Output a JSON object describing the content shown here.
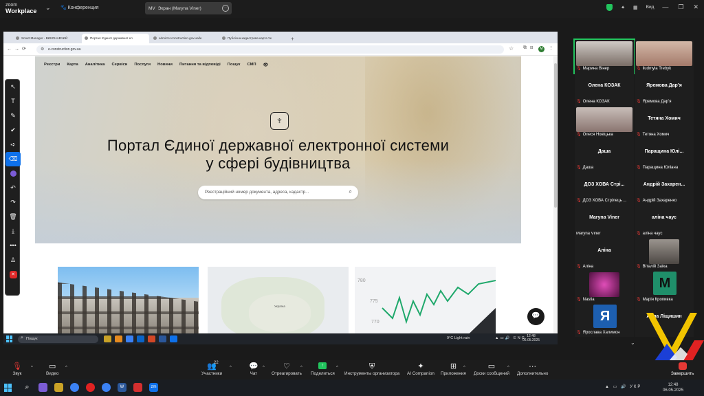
{
  "zoom": {
    "brand_line1": "zoom",
    "brand_line2": "Workplace",
    "meeting_name": "Конференция",
    "share_badge": "MV",
    "share_label": "Экран (Maryna Viner)",
    "view_label": "Вид"
  },
  "browser": {
    "tabs": [
      "Smart Manager - ВИКОНАВЧИЙ",
      "Портал Єдиної державної ел",
      "edmirror.construction.gov.ua/le",
      "Публічна кадастрова карта Ук"
    ],
    "new_tab": "+",
    "url": "e-construction.gov.ua",
    "profile_initial": "M"
  },
  "site": {
    "nav": [
      "Реєстри",
      "Карта",
      "Аналітика",
      "Сервіси",
      "Послуги",
      "Новини",
      "Питання та відповіді",
      "Пошук",
      "СМП"
    ],
    "title_line1": "Портал Єдиної державної електронної системи",
    "title_line2": "у сфері будівництва",
    "search_placeholder": "Реєстраційний номер документа, адреса, кадастр...",
    "map_label": "Україна",
    "chart_ticks": [
      "780",
      "775",
      "770"
    ]
  },
  "win_taskbar": {
    "search_placeholder": "Пошук",
    "weather": "9°C  Light rain",
    "lang": "ENG",
    "time": "12:48",
    "date": "06.05.2025"
  },
  "participants": [
    {
      "big": "",
      "sub": "Марина Вінер",
      "photo": "#8a7d78"
    },
    {
      "big": "",
      "sub": "liudmyla Trebyk",
      "photo": "#a47a6a"
    },
    {
      "big": "Олена КОЗАК",
      "sub": "Олена КОЗАК"
    },
    {
      "big": "Яремова Дар’я",
      "sub": "Яремова Дар’я"
    },
    {
      "big": "",
      "sub": "Олеся Новіцька",
      "photo": "#9a8a85"
    },
    {
      "big": "Тетяна Хомич",
      "sub": "Тетяна Хомич"
    },
    {
      "big": "Даша",
      "sub": "Даша"
    },
    {
      "big": "Паращина Юлі...",
      "sub": "Паращина Юліана"
    },
    {
      "big": "ДОЗ ХОВА Стрі...",
      "sub": "ДОЗ ХОВА Стрілець ..."
    },
    {
      "big": "Андрій Захарен...",
      "sub": "Андрій Захаренко"
    },
    {
      "big": "Maryna Viner",
      "sub": "Maryna Viner"
    },
    {
      "big": "аліна чаус",
      "sub": "аліна чаус"
    },
    {
      "big": "Аліна",
      "sub": "Аліна"
    },
    {
      "big": "",
      "sub": "Віталій Заїка",
      "photo": "#6b6560"
    },
    {
      "big": "",
      "sub": "Nastia",
      "photo": "#b02a8a"
    },
    {
      "big": "",
      "sub": "Марія Кропивка",
      "avatar": "M",
      "avatar_color": "#1f8f6a"
    },
    {
      "big": "",
      "sub": "Ярослава Халимон",
      "avatar": "Я",
      "avatar_color": "#1d5fb0"
    },
    {
      "big": "Алла Ліщишин",
      "sub": ""
    }
  ],
  "toolbar": {
    "mute": "Звук",
    "video": "Видео",
    "participants": "Участники",
    "participants_count": "22",
    "chat": "Чат",
    "react": "Отреагировать",
    "share": "Поделиться",
    "host_tools": "Инструменты организатора",
    "ai": "AI Companion",
    "apps": "Приложения",
    "whiteboards": "Доски сообщений",
    "more": "Дополнительно",
    "end": "Завершить"
  },
  "os_taskbar": {
    "lang": "УКР",
    "time": "12:48",
    "date": "06.05.2025"
  },
  "colors": {
    "accent_green": "#22c55e",
    "end_red": "#e53935",
    "zoom_blue": "#0e71eb"
  }
}
